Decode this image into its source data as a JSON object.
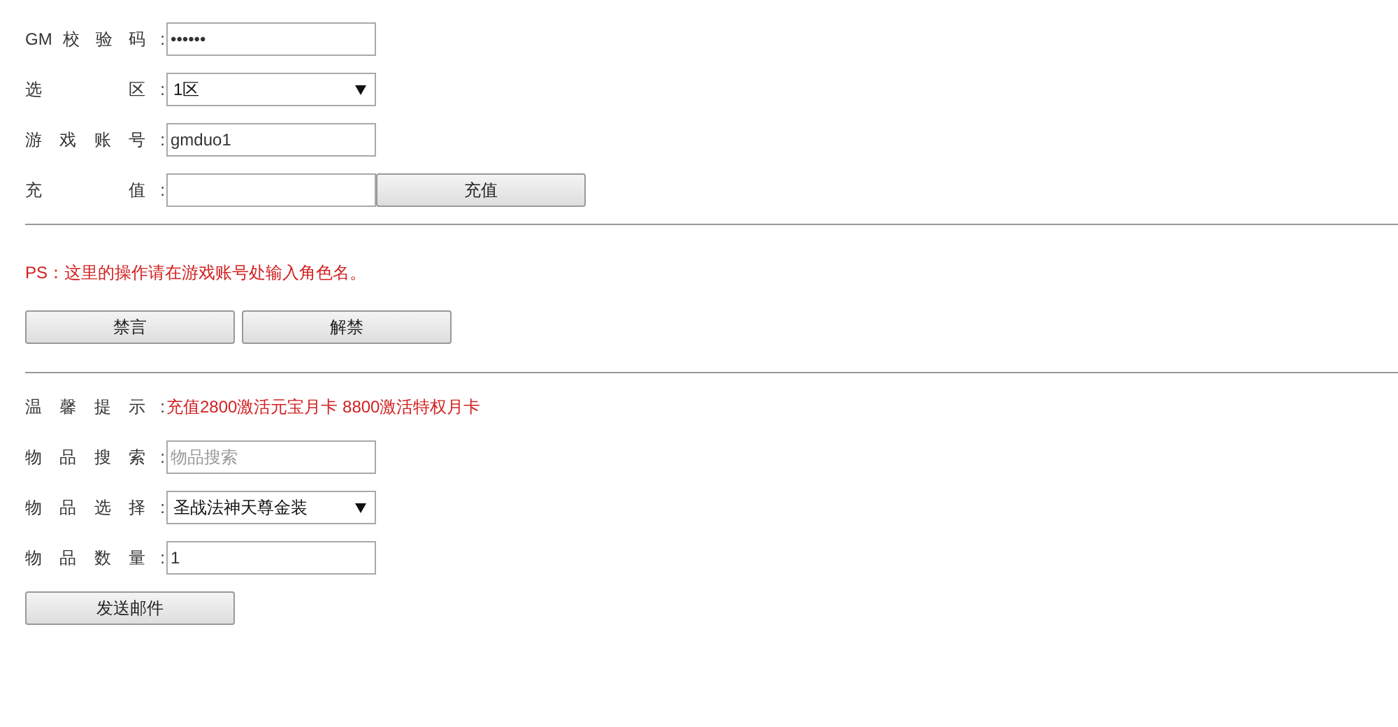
{
  "sections": [
    {
      "rows": [
        {
          "kind": "input",
          "label": "GM 校 验 码",
          "separator": ":",
          "value": "••••••"
        },
        {
          "kind": "select",
          "label": "选 区",
          "separator": ":",
          "value": "1区"
        },
        {
          "kind": "input",
          "label": "游 戏 账 号",
          "separator": ":",
          "value": "gmduo1"
        },
        {
          "kind": "input",
          "label": "充 值",
          "separator": ":",
          "value": "",
          "button": "充值"
        }
      ]
    },
    {
      "notice": "PS：这里的操作请在游戏账号处输入角色名。",
      "buttons": [
        "禁言",
        "解禁"
      ]
    },
    {
      "rows": [
        {
          "kind": "note",
          "label": "温 馨 提 示",
          "separator": ":",
          "text": "充值2800激活元宝月卡 8800激活特权月卡"
        },
        {
          "kind": "input",
          "label": "物 品 搜 索",
          "separator": ":",
          "placeholder": "物品搜索"
        },
        {
          "kind": "select",
          "label": "物 品 选 择",
          "separator": ":",
          "value": "圣战法神天尊金装"
        },
        {
          "kind": "input",
          "label": "物 品 数 量",
          "separator": ":",
          "value": "1"
        }
      ],
      "buttons": [
        "发送邮件"
      ]
    }
  ]
}
